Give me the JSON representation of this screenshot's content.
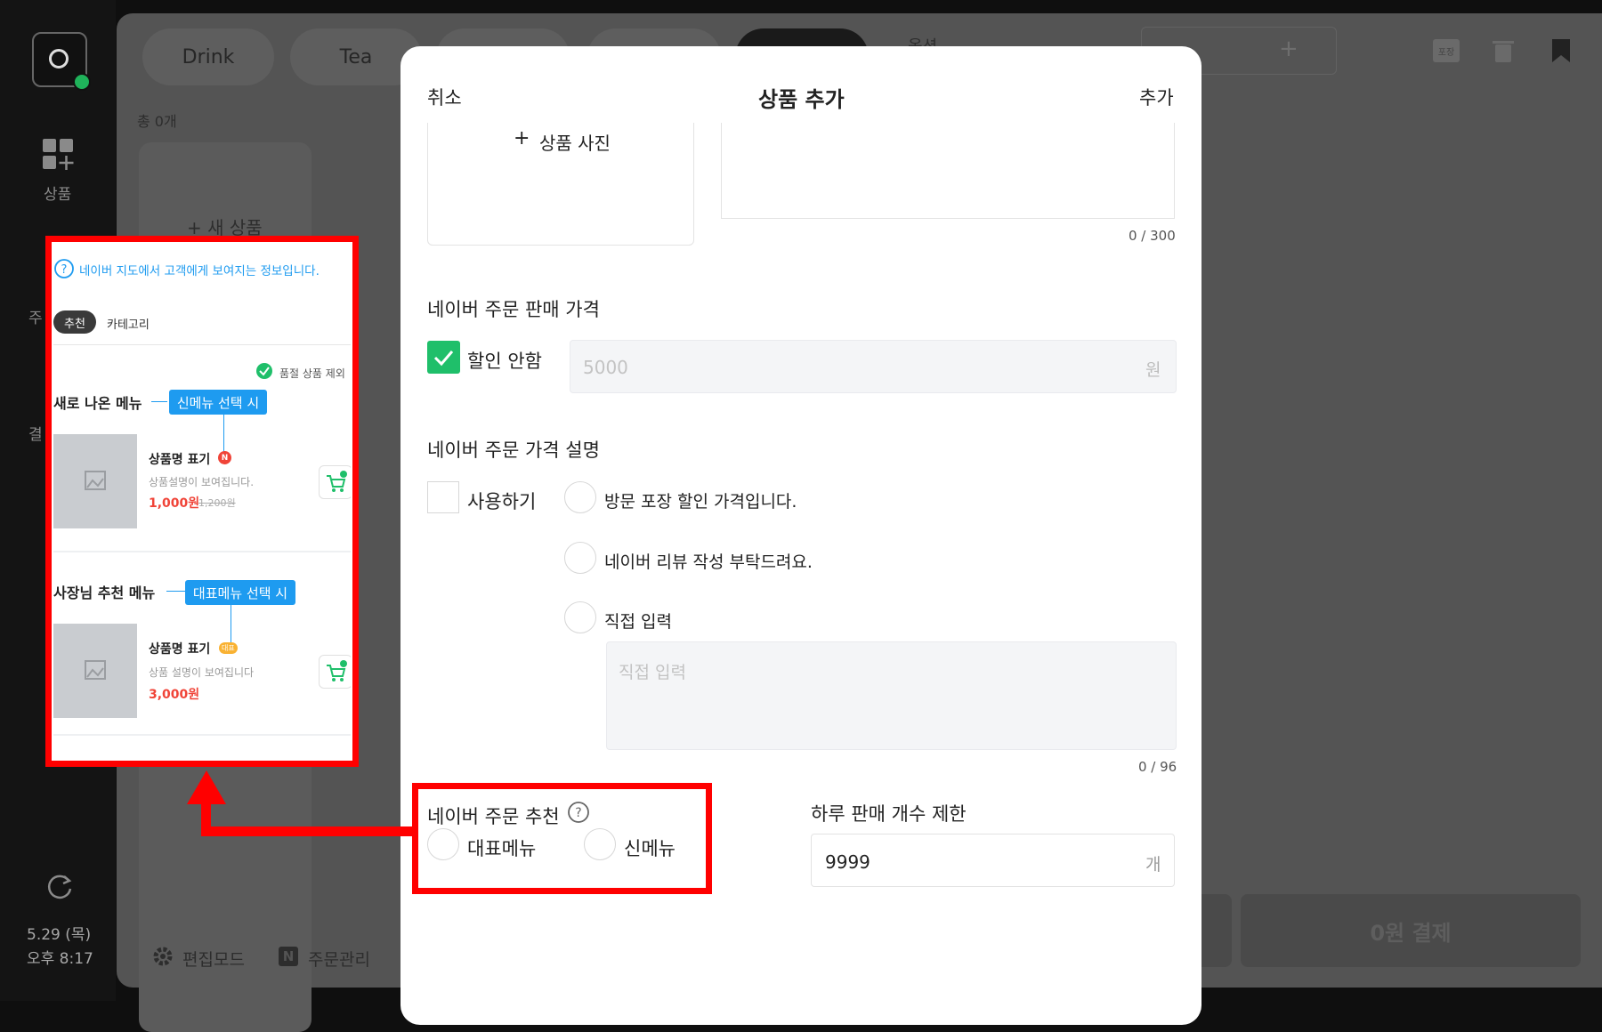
{
  "sidebar": {
    "products_label": "상품",
    "order_stub": "주",
    "payment_stub": "결",
    "date": "5.29 (목)",
    "time": "오후 8:17"
  },
  "main": {
    "tabs": [
      "Drink",
      "Tea"
    ],
    "option_label": "옵션",
    "total_count": "총 0개",
    "new_product": "+ 새 상품",
    "edit_mode": "편집모드",
    "order_manage": "주문관리",
    "pay_button": "0원 결제",
    "pack_label": "포장"
  },
  "modal": {
    "cancel": "취소",
    "title": "상품 추가",
    "add": "추가",
    "photo_label": "상품 사진",
    "desc_counter": "0 / 300",
    "price_section": "네이버 주문 판매 가격",
    "no_discount": "할인 안함",
    "price_value": "5000",
    "price_unit": "원",
    "price_desc_section": "네이버 주문 가격 설명",
    "use_label": "사용하기",
    "options": [
      "방문 포장 할인 가격입니다.",
      "네이버 리뷰 작성 부탁드려요.",
      "직접 입력"
    ],
    "custom_placeholder": "직접 입력",
    "custom_counter": "0 / 96",
    "recommend_label": "네이버 주문 추천",
    "rep_menu": "대표메뉴",
    "new_menu": "신메뉴",
    "daily_limit_label": "하루 판매 개수 제한",
    "daily_limit_value": "9999",
    "daily_limit_unit": "개"
  },
  "preview": {
    "info": "네이버 지도에서 고객에게 보여지는 정보입니다.",
    "tab_recommend": "추천",
    "tab_category": "카테고리",
    "soldout": "품절 상품 제외",
    "new_menu_title": "새로 나온 메뉴",
    "new_tag": "신메뉴 선택 시",
    "item1_name": "상품명 표기",
    "item1_desc": "상품설명이 보여집니다.",
    "item1_price": "1,000원",
    "item1_old": "1,200원",
    "owner_title": "사장님 추천 메뉴",
    "rep_tag": "대표메뉴 선택 시",
    "item2_name": "상품명 표기",
    "item2_badge": "대표",
    "item2_desc": "상품 설명이 보여집니다",
    "item2_price": "3,000원"
  },
  "colors": {
    "accent_green": "#1fbf6a",
    "highlight_red": "#ff0000",
    "tag_blue": "#1e9bf0",
    "price_red": "#f04438"
  }
}
